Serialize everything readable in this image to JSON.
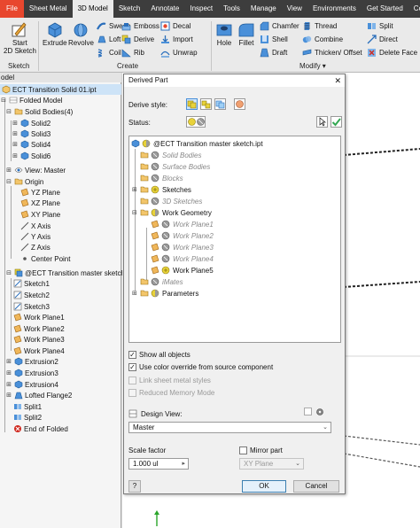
{
  "ribbon": {
    "tabs": [
      "File",
      "Sheet Metal",
      "3D Model",
      "Sketch",
      "Annotate",
      "Inspect",
      "Tools",
      "Manage",
      "View",
      "Environments",
      "Get Started",
      "Collab"
    ],
    "active_tab": "3D Model",
    "sketch_group": {
      "start_label": "Start",
      "sketch_label": "2D Sketch",
      "group_label": "Sketch"
    },
    "create_group": {
      "extrude": "Extrude",
      "revolve": "Revolve",
      "sweep": "Sweep",
      "loft": "Loft",
      "coil": "Coil",
      "emboss": "Emboss",
      "derive": "Derive",
      "rib": "Rib",
      "decal": "Decal",
      "import": "Import",
      "unwrap": "Unwrap",
      "group_label": "Create"
    },
    "modify_group": {
      "hole": "Hole",
      "fillet": "Fillet",
      "chamfer": "Chamfer",
      "shell": "Shell",
      "draft": "Draft",
      "thread": "Thread",
      "combine": "Combine",
      "thicken": "Thicken/ Offset",
      "split": "Split",
      "direct": "Direct",
      "delete_face": "Delete Face",
      "group_label": "Modify"
    }
  },
  "browser": {
    "header_fragment": "odel",
    "items": [
      "ECT Transition Solid 01.ipt",
      "Folded Model",
      "Solid Bodies(4)",
      "Solid2",
      "Solid3",
      "Solid4",
      "Solid6",
      "View: Master",
      "Origin",
      "YZ Plane",
      "XZ Plane",
      "XY Plane",
      "X Axis",
      "Y Axis",
      "Z Axis",
      "Center Point",
      "@ECT Transition master sketch.ipt",
      "Sketch1",
      "Sketch2",
      "Sketch3",
      "Work Plane1",
      "Work Plane2",
      "Work Plane3",
      "Work Plane4",
      "Extrusion2",
      "Extrusion3",
      "Extrusion4",
      "Lofted Flange2",
      "Split1",
      "Split2",
      "End of Folded"
    ]
  },
  "dialog": {
    "title": "Derived Part",
    "close_glyph": "✕",
    "derive_style_label": "Derive style:",
    "status_label": "Status:",
    "tree": {
      "root": "@ECT Transition master sketch.ipt",
      "nodes": [
        "Solid Bodies",
        "Surface Bodies",
        "Blocks",
        "Sketches",
        "3D Sketches",
        "Work Geometry",
        "Work Plane1",
        "Work Plane2",
        "Work Plane3",
        "Work Plane4",
        "Work Plane5",
        "iMates",
        "Parameters"
      ]
    },
    "show_all_objects": "Show all objects",
    "use_color_override": "Use color override from source component",
    "link_sheet_metal": "Link sheet metal styles",
    "reduced_memory": "Reduced Memory Mode",
    "design_view_label": "Design View:",
    "design_view_value": "Master",
    "scale_factor_label": "Scale factor",
    "scale_factor_value": "1.000 ul",
    "mirror_part_label": "Mirror part",
    "mirror_plane_value": "XY Plane",
    "ok_label": "OK",
    "cancel_label": "Cancel",
    "help_glyph": "?"
  },
  "colors": {
    "file_tab": "#e8472e",
    "folder": "#f3c66b",
    "sketch_yellow": "#e8d23a",
    "workplane": "#f0b75a",
    "accent_blue": "#2a6ebb",
    "ok_green": "#34a853"
  }
}
